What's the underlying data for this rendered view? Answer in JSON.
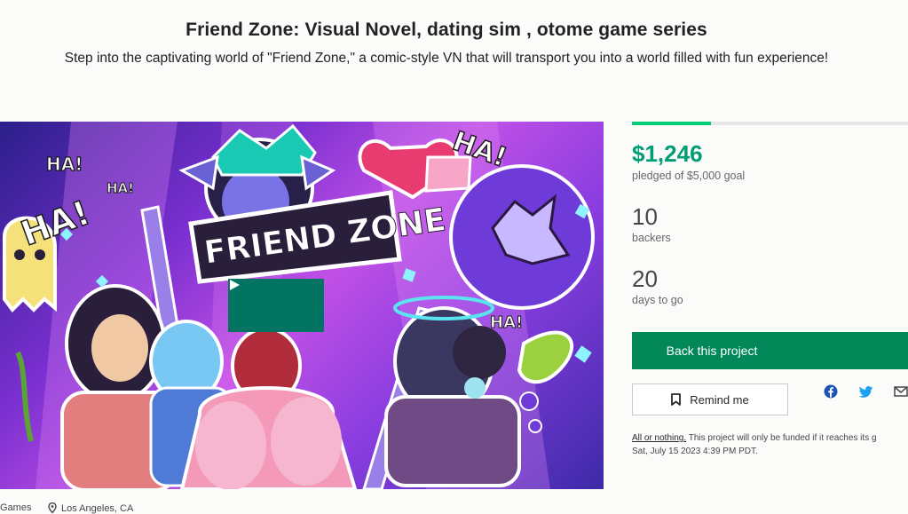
{
  "project": {
    "title": "Friend Zone: Visual Novel, dating sim , otome game series",
    "blurb": "Step into the captivating world of \"Friend Zone,\" a comic-style VN that will transport you into a world filled with fun experience!"
  },
  "media": {
    "art_text": "FRIEND ZONE",
    "ha_text": "HA!",
    "ha_text_2": "HA!",
    "ha_text_3": "HA!",
    "ha_text_4": "HA!",
    "ha_text_5": "HA!",
    "play_icon": "play-icon"
  },
  "stats": {
    "progress_fraction": 0.285,
    "pledged": "$1,246",
    "pledged_caption": "pledged of $5,000 goal",
    "backers": "10",
    "backers_caption": "backers",
    "days": "20",
    "days_caption": "days to go"
  },
  "actions": {
    "back_label": "Back this project",
    "remind_label": "Remind me",
    "remind_icon": "bookmark-icon",
    "share_icons": [
      "facebook-icon",
      "twitter-icon",
      "email-icon"
    ]
  },
  "funding": {
    "link_text": "All or nothing.",
    "note": " This project will only be funded if it reaches its g",
    "deadline": "Sat, July 15 2023 4:39 PM PDT."
  },
  "footer": {
    "category": "Games",
    "location": "Los Angeles, CA"
  },
  "colors": {
    "accent_green": "#009e74",
    "button_green": "#028858",
    "progress_green": "#05ce78",
    "play_button": "#037362"
  }
}
